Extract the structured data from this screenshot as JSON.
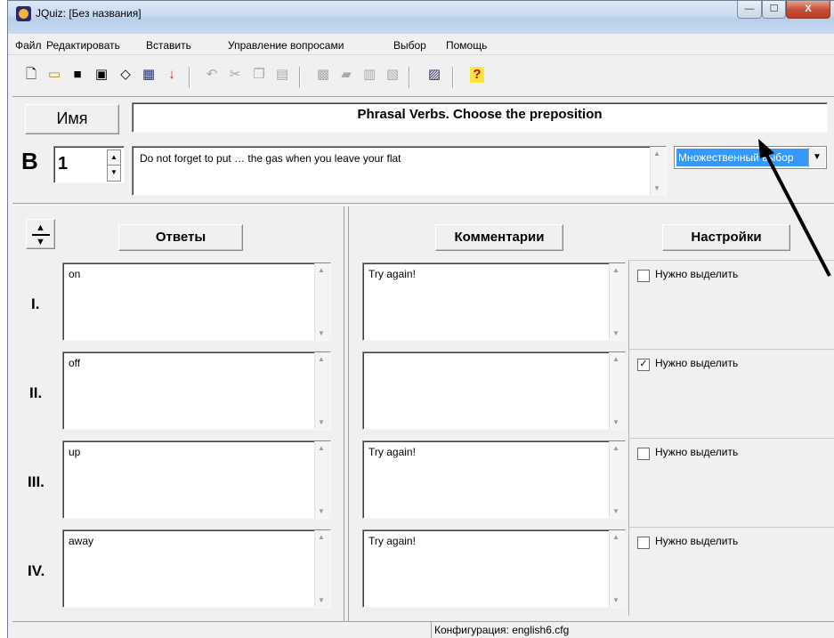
{
  "window": {
    "title": "JQuiz: [Без названия]",
    "min_glyph": "—",
    "max_glyph": "☐",
    "close_glyph": "X"
  },
  "menu": [
    {
      "label": "Файл"
    },
    {
      "label": "Редактировать"
    },
    {
      "label": "Вставить"
    },
    {
      "label": "Управление вопросами"
    },
    {
      "label": "Выбор"
    },
    {
      "label": "Помощь"
    }
  ],
  "toolbar": {
    "icons": [
      "new-file-icon",
      "open-folder-icon",
      "save-icon",
      "save-as-icon",
      "eraser-icon",
      "web-export-icon",
      "down-arrow-icon",
      "undo-icon",
      "cut-icon",
      "copy-icon",
      "paste-icon",
      "web-page-icon",
      "hot-potatoes-icon",
      "pattern-icon",
      "pattern2-icon",
      "color-icon",
      "help-icon"
    ],
    "help_glyph": "?"
  },
  "quiz": {
    "name_button": "Имя",
    "title": "Phrasal Verbs. Choose the preposition",
    "question_letter": "B",
    "question_number": "1",
    "question_text": "Do not forget to put … the gas when you leave your flat",
    "question_type": "Множественный выбор"
  },
  "headers": {
    "answers": "Ответы",
    "comments": "Комментарии",
    "settings": "Настройки"
  },
  "answers": [
    {
      "numeral": "I.",
      "text": "on",
      "comment": "Try again!",
      "correct": false,
      "correct_label": "Нужно выделить"
    },
    {
      "numeral": "II.",
      "text": "off",
      "comment": "",
      "correct": true,
      "correct_label": "Нужно выделить"
    },
    {
      "numeral": "III.",
      "text": "up",
      "comment": "Try again!",
      "correct": false,
      "correct_label": "Нужно выделить"
    },
    {
      "numeral": "IV.",
      "text": "away",
      "comment": "Try again!",
      "correct": false,
      "correct_label": "Нужно выделить"
    }
  ],
  "status": {
    "config": "Конфигурация: english6.cfg"
  },
  "colors": {
    "selection": "#3399ff",
    "window_bg": "#f0f0f0"
  }
}
